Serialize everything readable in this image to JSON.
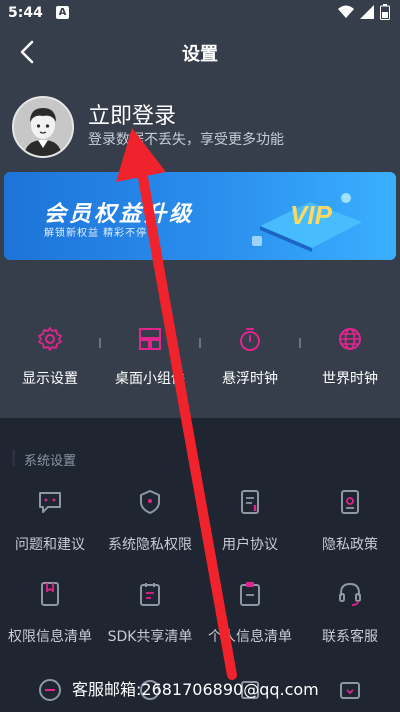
{
  "status_bar": {
    "time": "5:44",
    "notification_letter": "A"
  },
  "header": {
    "title": "设置"
  },
  "profile": {
    "login_text": "立即登录",
    "subtitle": "登录数据不丢失，享受更多功能"
  },
  "banner": {
    "title": "会员权益升级",
    "subtitle": "解锁新权益 精彩不停",
    "badge": "VIP"
  },
  "shortcuts": [
    {
      "label": "显示设置",
      "icon": "gear-icon"
    },
    {
      "label": "桌面小组件",
      "icon": "widgets-icon"
    },
    {
      "label": "悬浮时钟",
      "icon": "timer-icon"
    },
    {
      "label": "世界时钟",
      "icon": "globe-icon"
    }
  ],
  "section": {
    "title": "系统设置"
  },
  "grid": [
    {
      "label": "问题和建议",
      "icon": "feedback-icon"
    },
    {
      "label": "系统隐私权限",
      "icon": "shield-icon"
    },
    {
      "label": "用户协议",
      "icon": "document-icon"
    },
    {
      "label": "隐私政策",
      "icon": "privacy-doc-icon"
    },
    {
      "label": "权限信息清单",
      "icon": "bookmark-doc-icon"
    },
    {
      "label": "SDK共享清单",
      "icon": "calendar-list-icon"
    },
    {
      "label": "个人信息清单",
      "icon": "clipboard-icon"
    },
    {
      "label": "联系客服",
      "icon": "headset-icon"
    }
  ],
  "footer": {
    "email": "客服邮箱:2681706890@qq.com"
  },
  "colors": {
    "accent": "#e0258c",
    "banner": "#2a8fee",
    "arrow": "#f0232d"
  }
}
